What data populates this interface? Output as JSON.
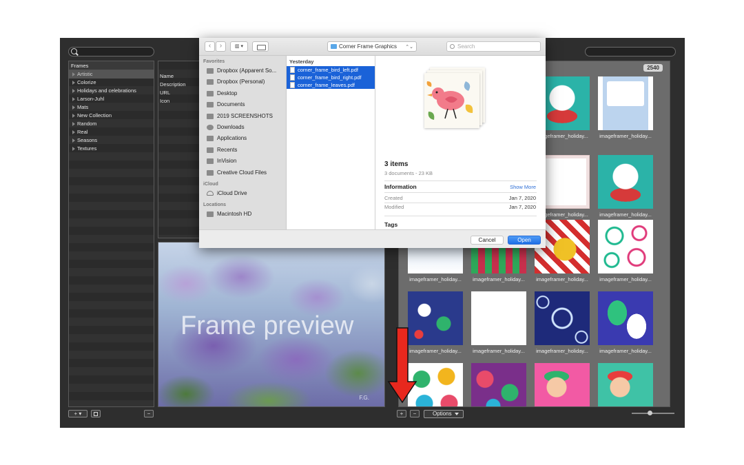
{
  "sidebar": {
    "header": "Frames",
    "items": [
      "Artistic",
      "Colorize",
      "Holidays and celebrations",
      "Larson-Juhl",
      "Mats",
      "New Collection",
      "Random",
      "Real",
      "Seasons",
      "Textures"
    ]
  },
  "details": {
    "fields": [
      "Name",
      "Description",
      "URL",
      "Icon"
    ]
  },
  "preview": {
    "title": "Frame preview",
    "signature": "F.G."
  },
  "grid": {
    "count": "2540",
    "caption": "imageframer_holiday..."
  },
  "toolbar": {
    "add_label": "+",
    "remove_label": "−",
    "options_label": "Options",
    "left_add_label": "+ ▾",
    "left_remove_label": "−"
  },
  "dialog": {
    "back_label": "‹",
    "forward_label": "›",
    "view_label": "▥ ▾",
    "location": "Corner Frame Graphics",
    "search_placeholder": "Search",
    "sections": {
      "favorites": "Favorites",
      "icloud": "iCloud",
      "locations": "Locations"
    },
    "favorites": [
      "Dropbox (Apparent So...",
      "Dropbox (Personal)",
      "Desktop",
      "Documents",
      "2019 SCREENSHOTS",
      "Downloads",
      "Applications",
      "Recents",
      "InVision",
      "Creative Cloud Files"
    ],
    "icloud": [
      "iCloud Drive"
    ],
    "locations": [
      "Macintosh HD"
    ],
    "files_header": "Yesterday",
    "files": [
      "corner_frame_bird_left.pdf",
      "corner_frame_bird_right.pdf",
      "corner_frame_leaves.pdf"
    ],
    "summary": {
      "items": "3 items",
      "sub": "3 documents - 23 KB",
      "info_header": "Information",
      "show_more": "Show More",
      "created_label": "Created",
      "created_value": "Jan 7, 2020",
      "modified_label": "Modified",
      "modified_value": "Jan 7, 2020",
      "tags_header": "Tags"
    },
    "cancel_label": "Cancel",
    "open_label": "Open"
  },
  "colors": {
    "accent_blue": "#1a62d8",
    "arrow_red": "#e8281e"
  }
}
